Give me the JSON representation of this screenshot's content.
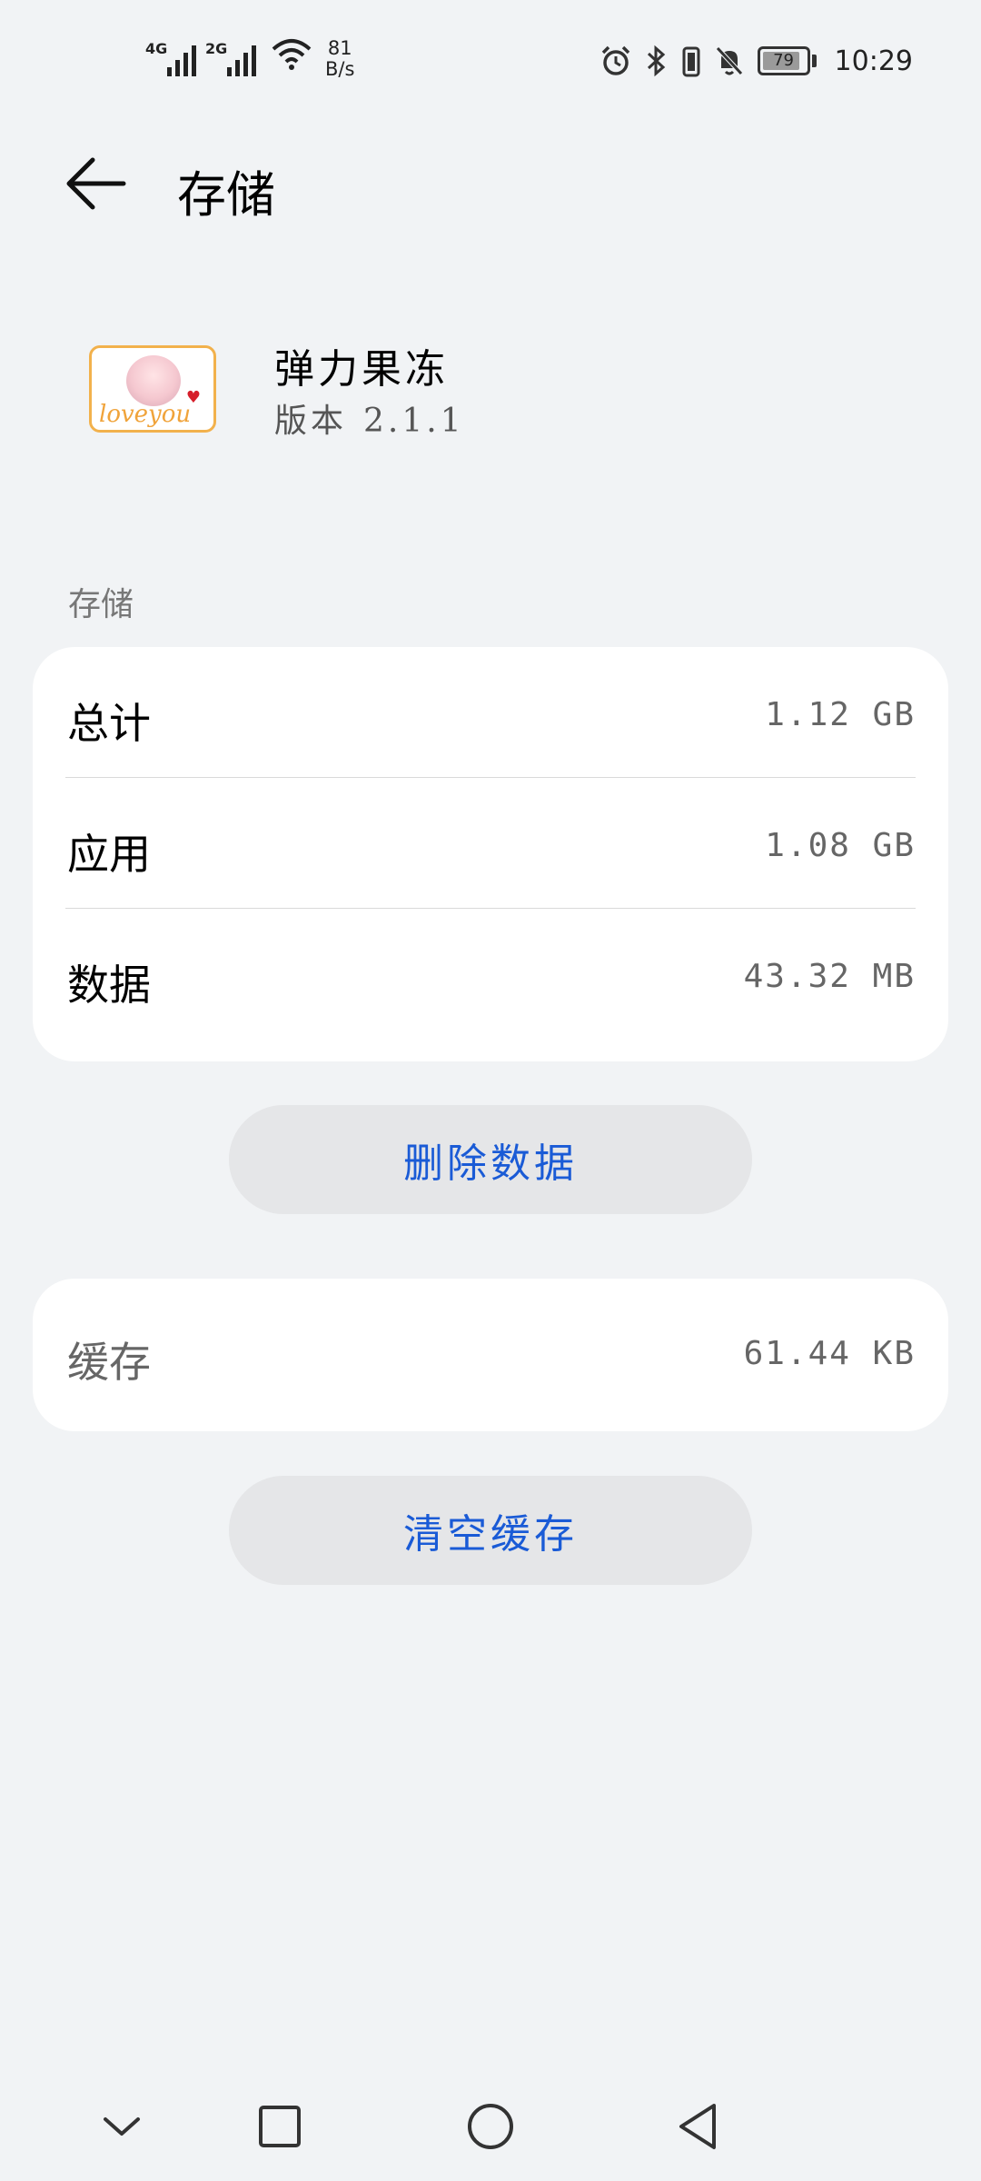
{
  "status_bar": {
    "net1": "4G",
    "net2": "2G",
    "speed_value": "81",
    "speed_unit": "B/s",
    "battery_percent": "79",
    "time": "10:29"
  },
  "header": {
    "title": "存储"
  },
  "app": {
    "name": "弹力果冻",
    "version_label": "版本",
    "version_value": "2.1.1",
    "icon_text": "loveyou"
  },
  "storage": {
    "section_label": "存储",
    "rows": [
      {
        "label": "总计",
        "value": "1.12 GB"
      },
      {
        "label": "应用",
        "value": "1.08 GB"
      },
      {
        "label": "数据",
        "value": "43.32 MB"
      }
    ],
    "delete_button": "删除数据"
  },
  "cache": {
    "label": "缓存",
    "value": "61.44 KB",
    "clear_button": "清空缓存"
  },
  "colors": {
    "background": "#f1f3f5",
    "card": "#ffffff",
    "accent": "#1a5bd6",
    "pill": "#e5e6e8"
  }
}
